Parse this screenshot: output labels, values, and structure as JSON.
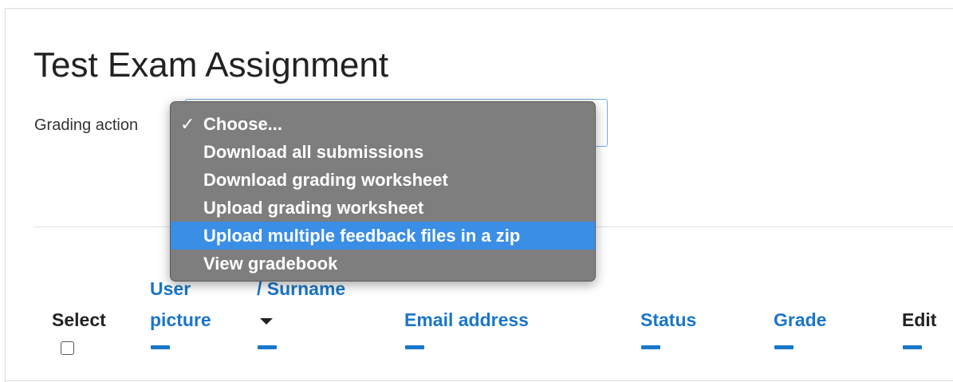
{
  "page": {
    "title": "Test Exam Assignment"
  },
  "grading": {
    "label": "Grading action"
  },
  "dropdown": {
    "selected_check": "✓",
    "items": [
      {
        "label": "Choose..."
      },
      {
        "label": "Download all submissions"
      },
      {
        "label": "Download grading worksheet"
      },
      {
        "label": "Upload grading worksheet"
      },
      {
        "label": "Upload multiple feedback files in a zip"
      },
      {
        "label": "View gradebook"
      }
    ],
    "highlight_color": "#3a8ee6",
    "menu_color": "#7e7e7e"
  },
  "table": {
    "columns": {
      "select": "Select",
      "user_picture_line1": "User",
      "user_picture_line2": "picture",
      "surname": "/ Surname",
      "email": "Email address",
      "status": "Status",
      "grade": "Grade",
      "edit": "Edit"
    },
    "link_color": "#1a76c9"
  }
}
